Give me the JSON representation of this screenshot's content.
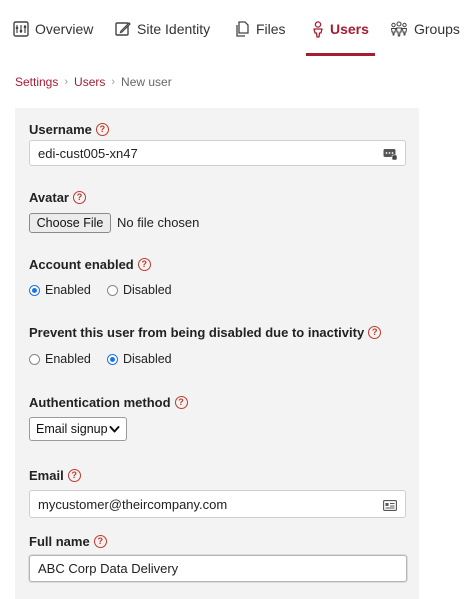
{
  "tabs": [
    {
      "label": "Overview",
      "icon": "overview-icon"
    },
    {
      "label": "Site Identity",
      "icon": "edit-icon"
    },
    {
      "label": "Files",
      "icon": "files-icon"
    },
    {
      "label": "Users",
      "icon": "user-icon"
    },
    {
      "label": "Groups",
      "icon": "groups-icon"
    }
  ],
  "active_tab": "Users",
  "accent_color": "#a51d35",
  "breadcrumb": {
    "items": [
      "Settings",
      "Users"
    ],
    "current": "New user"
  },
  "form": {
    "username": {
      "label": "Username",
      "value": "edi-cust005-xn47"
    },
    "avatar": {
      "label": "Avatar",
      "button": "Choose File",
      "status": "No file chosen"
    },
    "account_enabled": {
      "label": "Account enabled",
      "options": [
        "Enabled",
        "Disabled"
      ],
      "selected": "Enabled"
    },
    "prevent_disable": {
      "label": "Prevent this user from being disabled due to inactivity",
      "options": [
        "Enabled",
        "Disabled"
      ],
      "selected": "Disabled"
    },
    "auth_method": {
      "label": "Authentication method",
      "selected": "Email signup"
    },
    "email": {
      "label": "Email",
      "value": "mycustomer@theircompany.com"
    },
    "full_name": {
      "label": "Full name",
      "value": "ABC Corp Data Delivery"
    }
  }
}
